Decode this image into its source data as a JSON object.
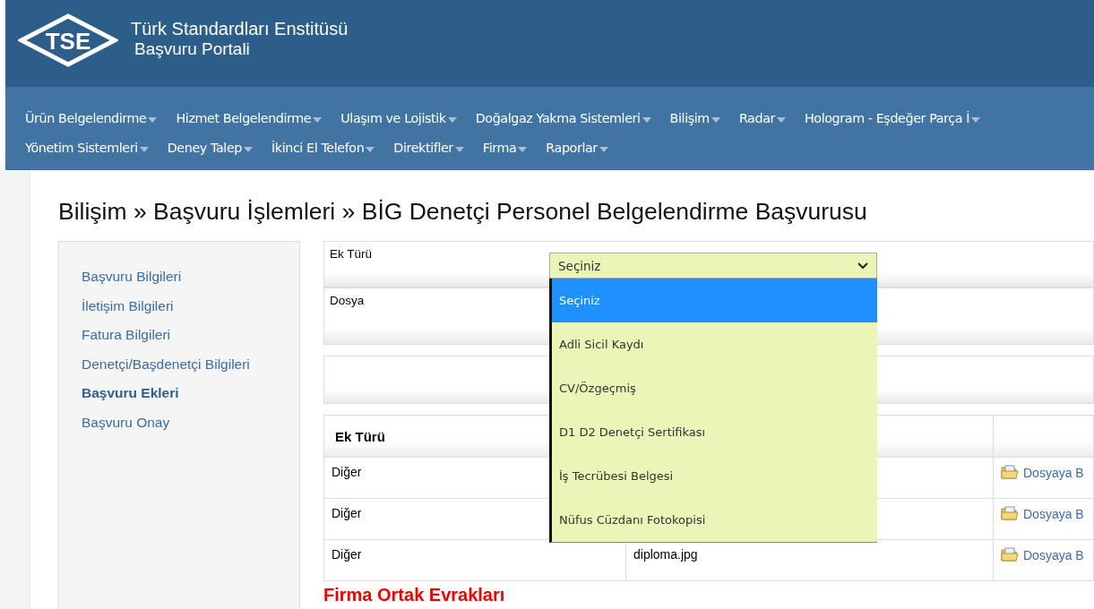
{
  "header": {
    "logo_text": "TSE",
    "title": "Türk Standardları Enstitüsü",
    "subtitle": "Başvuru Portali"
  },
  "nav": [
    [
      {
        "label": "Ürün Belgelendirme"
      },
      {
        "label": "Hizmet Belgelendirme"
      },
      {
        "label": "Ulaşım ve Lojistik"
      },
      {
        "label": "Doğalgaz Yakma Sistemleri"
      },
      {
        "label": "Bilişim"
      },
      {
        "label": "Radar"
      },
      {
        "label": "Hologram - Eşdeğer Parça İ"
      }
    ],
    [
      {
        "label": "Yönetim Sistemleri"
      },
      {
        "label": "Deney Talep"
      },
      {
        "label": "İkinci El Telefon"
      },
      {
        "label": "Direktifler"
      },
      {
        "label": "Firma"
      },
      {
        "label": "Raporlar"
      }
    ]
  ],
  "page_title": "Bilişim » Başvuru İşlemleri » BİG Denetçi Personel Belgelendirme Başvurusu",
  "sidebar": {
    "items": [
      {
        "label": "Başvuru Bilgileri",
        "selected": false
      },
      {
        "label": "İletişim Bilgileri",
        "selected": false
      },
      {
        "label": "Fatura Bilgileri",
        "selected": false
      },
      {
        "label": "Denetçi/Başdenetçi Bilgileri",
        "selected": false
      },
      {
        "label": "Başvuru Ekleri",
        "selected": true
      },
      {
        "label": "Başvuru Onay",
        "selected": false
      }
    ]
  },
  "form": {
    "fields": [
      {
        "label": "Ek Türü"
      },
      {
        "label": "Dosya"
      }
    ],
    "select": {
      "value": "Seçiniz",
      "expanded": true,
      "options": [
        {
          "label": "Seçiniz",
          "selected": true
        },
        {
          "label": "Adli Sicil Kaydı",
          "selected": false
        },
        {
          "label": "CV/Özgeçmiş",
          "selected": false
        },
        {
          "label": "D1 D2 Denetçi Sertifikası",
          "selected": false
        },
        {
          "label": "İş Tecrübesi Belgesi",
          "selected": false
        },
        {
          "label": "Nüfus Cüzdanı Fotokopisi",
          "selected": false
        }
      ]
    }
  },
  "table": {
    "columns": [
      "Ek Türü"
    ],
    "rows": [
      {
        "type": "Diğer",
        "file": null,
        "action": "Dosyaya B"
      },
      {
        "type": "Diğer",
        "file": null,
        "action": "Dosyaya B"
      },
      {
        "type": "Diğer",
        "file": "diploma.jpg",
        "action": "Dosyaya B"
      }
    ]
  },
  "section_heading": "Firma Ortak Evrakları"
}
